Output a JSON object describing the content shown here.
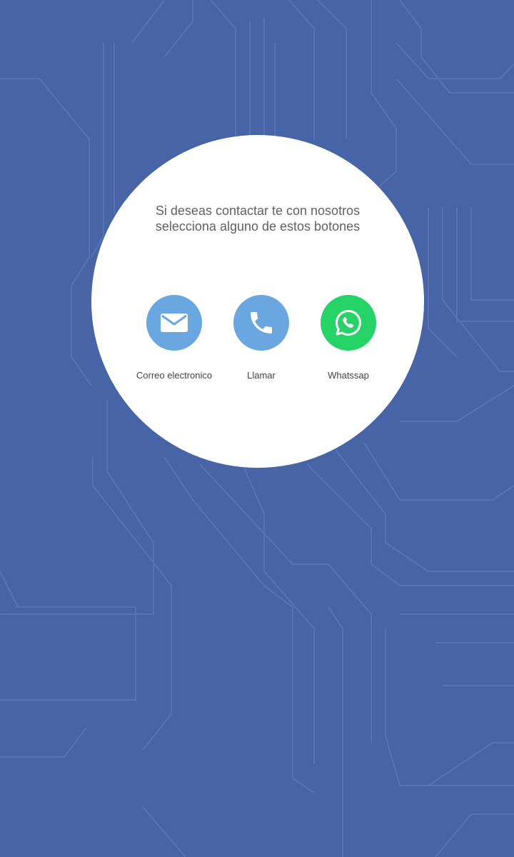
{
  "theme": {
    "background": "#4764a6",
    "circuit_line": "#5b76b3",
    "card": "#ffffff",
    "text": "#616161",
    "label_text": "#424242",
    "email_color": "#6aa6df",
    "call_color": "#6aa6df",
    "whatsapp_color": "#25d366"
  },
  "contact": {
    "intro_line1": "Si deseas contactar te con nosotros",
    "intro_line2": "selecciona alguno de estos botones",
    "actions": [
      {
        "icon": "envelope-icon",
        "label": "Correo electronico"
      },
      {
        "icon": "phone-icon",
        "label": "Llamar"
      },
      {
        "icon": "whatsapp-icon",
        "label": "Whatssap"
      }
    ]
  }
}
